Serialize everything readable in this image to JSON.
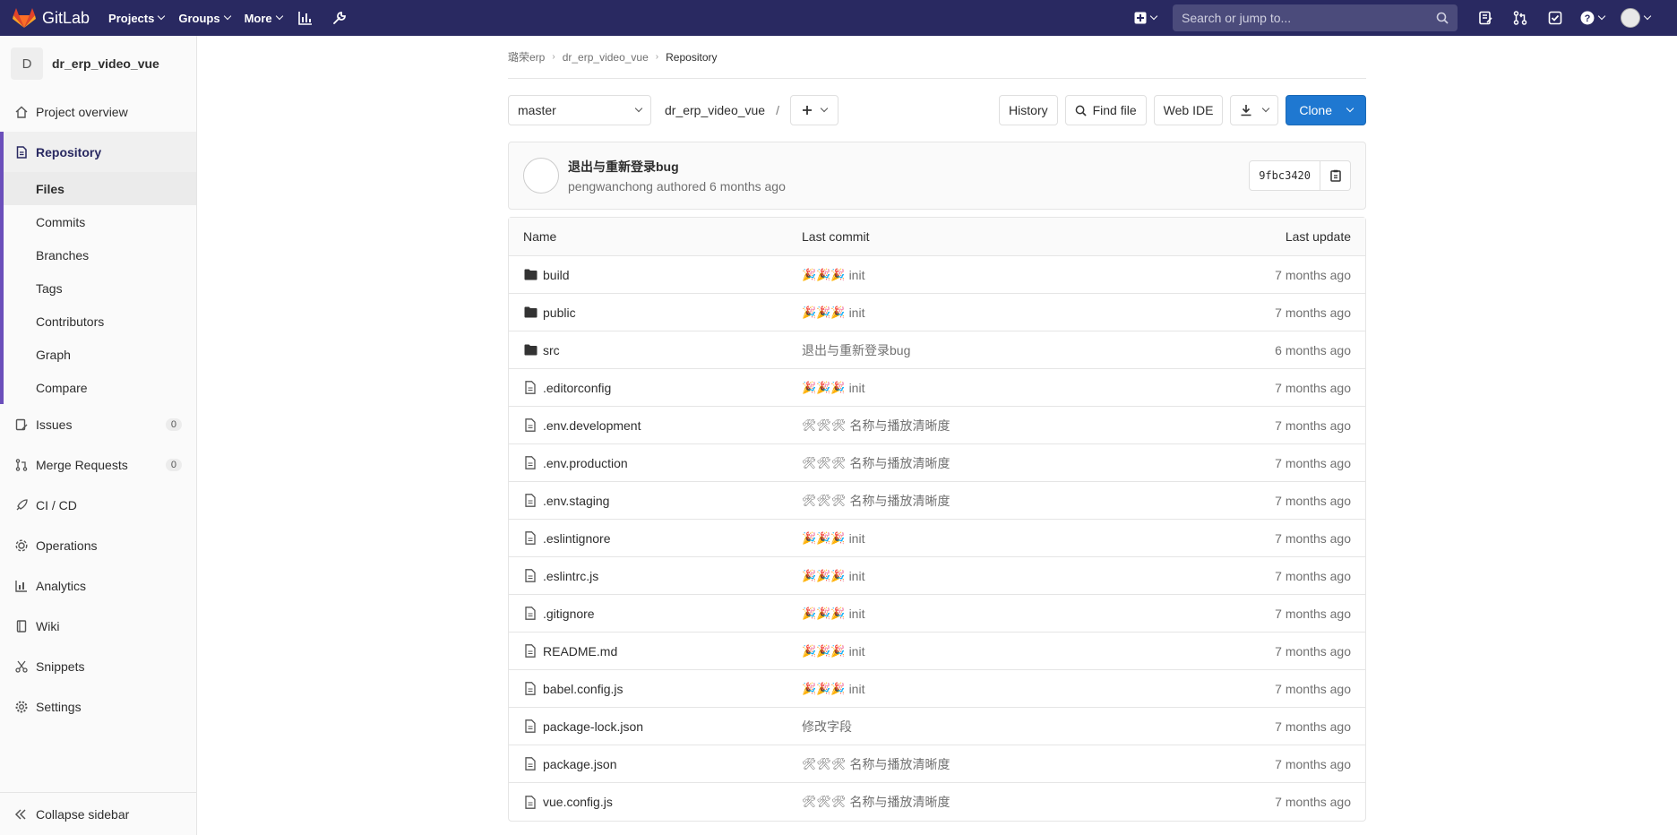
{
  "navbar": {
    "logo_text": "GitLab",
    "menu": [
      {
        "label": "Projects"
      },
      {
        "label": "Groups"
      },
      {
        "label": "More"
      }
    ],
    "search_placeholder": "Search or jump to...",
    "bg_color": "#292961"
  },
  "sidebar": {
    "project_initial": "D",
    "project_name": "dr_erp_video_vue",
    "items": {
      "overview": "Project overview",
      "repository": "Repository",
      "issues": "Issues",
      "issues_count": "0",
      "merge_requests": "Merge Requests",
      "merge_requests_count": "0",
      "cicd": "CI / CD",
      "operations": "Operations",
      "analytics": "Analytics",
      "wiki": "Wiki",
      "snippets": "Snippets",
      "settings": "Settings"
    },
    "sub_items": [
      "Files",
      "Commits",
      "Branches",
      "Tags",
      "Contributors",
      "Graph",
      "Compare"
    ],
    "collapse_label": "Collapse sidebar"
  },
  "breadcrumb": [
    "璐荣erp",
    "dr_erp_video_vue",
    "Repository"
  ],
  "repo_bar": {
    "branch": "master",
    "path": "dr_erp_video_vue",
    "slash": "/",
    "history": "History",
    "find_file": "Find file",
    "web_ide": "Web IDE",
    "clone": "Clone"
  },
  "last_commit": {
    "title": "退出与重新登录bug",
    "author": "pengwanchong",
    "meta": "pengwanchong authored 6 months ago",
    "sha": "9fbc3420"
  },
  "table": {
    "headers": {
      "name": "Name",
      "last_commit": "Last commit",
      "last_update": "Last update"
    },
    "rows": [
      {
        "name": "build",
        "type": "folder",
        "emoji": "🎉🎉🎉",
        "commit": "init",
        "updated": "7 months ago"
      },
      {
        "name": "public",
        "type": "folder",
        "emoji": "🎉🎉🎉",
        "commit": "init",
        "updated": "7 months ago"
      },
      {
        "name": "src",
        "type": "folder",
        "emoji": "",
        "commit": "退出与重新登录bug",
        "updated": "6 months ago"
      },
      {
        "name": ".editorconfig",
        "type": "file",
        "emoji": "🎉🎉🎉",
        "commit": "init",
        "updated": "7 months ago"
      },
      {
        "name": ".env.development",
        "type": "file",
        "emoji": "🛠🛠🛠",
        "commit": "名称与播放清晰度",
        "updated": "7 months ago"
      },
      {
        "name": ".env.production",
        "type": "file",
        "emoji": "🛠🛠🛠",
        "commit": "名称与播放清晰度",
        "updated": "7 months ago"
      },
      {
        "name": ".env.staging",
        "type": "file",
        "emoji": "🛠🛠🛠",
        "commit": "名称与播放清晰度",
        "updated": "7 months ago"
      },
      {
        "name": ".eslintignore",
        "type": "file",
        "emoji": "🎉🎉🎉",
        "commit": "init",
        "updated": "7 months ago"
      },
      {
        "name": ".eslintrc.js",
        "type": "file",
        "emoji": "🎉🎉🎉",
        "commit": "init",
        "updated": "7 months ago"
      },
      {
        "name": ".gitignore",
        "type": "file",
        "emoji": "🎉🎉🎉",
        "commit": "init",
        "updated": "7 months ago"
      },
      {
        "name": "README.md",
        "type": "file",
        "emoji": "🎉🎉🎉",
        "commit": "init",
        "updated": "7 months ago"
      },
      {
        "name": "babel.config.js",
        "type": "file",
        "emoji": "🎉🎉🎉",
        "commit": "init",
        "updated": "7 months ago"
      },
      {
        "name": "package-lock.json",
        "type": "file",
        "emoji": "",
        "commit": "修改字段",
        "updated": "7 months ago"
      },
      {
        "name": "package.json",
        "type": "file",
        "emoji": "🛠🛠🛠",
        "commit": "名称与播放清晰度",
        "updated": "7 months ago"
      },
      {
        "name": "vue.config.js",
        "type": "file",
        "emoji": "🛠🛠🛠",
        "commit": "名称与播放清晰度",
        "updated": "7 months ago"
      }
    ]
  },
  "colors": {
    "accent": "#6b4fbb",
    "primary": "#1f78d1",
    "logo": "#fc6d26"
  }
}
